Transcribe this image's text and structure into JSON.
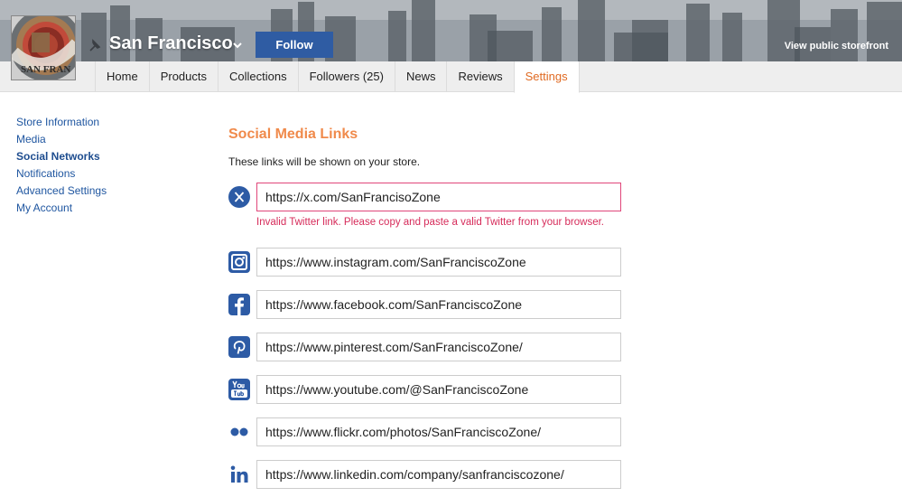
{
  "header": {
    "store_name": "San Francisco",
    "logo_text": "SAN FRANCISCO",
    "follow_label": "Follow",
    "storefront_link": "View public storefront",
    "colors": {
      "follow_bg": "#2f5ca3",
      "accent": "#e06a22"
    }
  },
  "tabs": [
    {
      "label": "Home",
      "active": false
    },
    {
      "label": "Products",
      "active": false
    },
    {
      "label": "Collections",
      "active": false
    },
    {
      "label": "Followers (25)",
      "active": false
    },
    {
      "label": "News",
      "active": false
    },
    {
      "label": "Reviews",
      "active": false
    },
    {
      "label": "Settings",
      "active": true
    }
  ],
  "sidebar": {
    "items": [
      {
        "label": "Store Information",
        "active": false
      },
      {
        "label": "Media",
        "active": false
      },
      {
        "label": "Social Networks",
        "active": true
      },
      {
        "label": "Notifications",
        "active": false
      },
      {
        "label": "Advanced Settings",
        "active": false
      },
      {
        "label": "My Account",
        "active": false
      }
    ]
  },
  "main": {
    "title": "Social Media Links",
    "description": "These links will be shown on your store.",
    "links": [
      {
        "network": "twitter",
        "icon": "x-icon",
        "value": "https://x.com/SanFrancisoZone",
        "invalid": true
      },
      {
        "network": "instagram",
        "icon": "instagram-icon",
        "value": "https://www.instagram.com/SanFranciscoZone",
        "invalid": false
      },
      {
        "network": "facebook",
        "icon": "facebook-icon",
        "value": "https://www.facebook.com/SanFranciscoZone",
        "invalid": false
      },
      {
        "network": "pinterest",
        "icon": "pinterest-icon",
        "value": "https://www.pinterest.com/SanFranciscoZone/",
        "invalid": false
      },
      {
        "network": "youtube",
        "icon": "youtube-icon",
        "value": "https://www.youtube.com/@SanFranciscoZone",
        "invalid": false
      },
      {
        "network": "flickr",
        "icon": "flickr-icon",
        "value": "https://www.flickr.com/photos/SanFranciscoZone/",
        "invalid": false
      },
      {
        "network": "linkedin",
        "icon": "linkedin-icon",
        "value": "https://www.linkedin.com/company/sanfranciscozone/",
        "invalid": false
      }
    ],
    "twitter_error": "Invalid Twitter link. Please copy and paste a valid Twitter from your browser."
  }
}
